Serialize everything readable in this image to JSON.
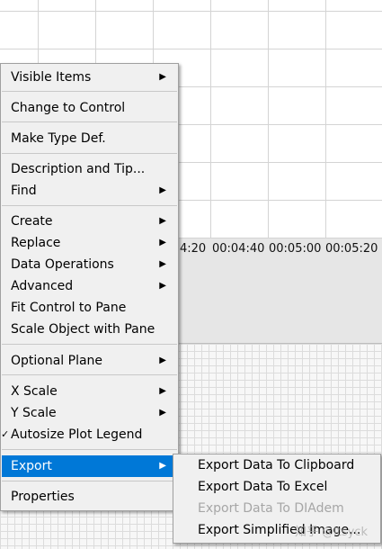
{
  "graph": {
    "x_tick_labels": [
      "4:20",
      "00:04:40",
      "00:05:00",
      "00:05:20"
    ]
  },
  "context_menu": {
    "items": {
      "visible_items": "Visible Items",
      "change_to_control": "Change to Control",
      "make_type_def": "Make Type Def.",
      "description_and_tip": "Description and Tip...",
      "find": "Find",
      "create": "Create",
      "replace": "Replace",
      "data_operations": "Data Operations",
      "advanced": "Advanced",
      "fit_control_to_pane": "Fit Control to Pane",
      "scale_object_with_pane": "Scale Object with Pane",
      "optional_plane": "Optional Plane",
      "x_scale": "X Scale",
      "y_scale": "Y Scale",
      "autosize_plot_legend": "Autosize Plot Legend",
      "export": "Export",
      "properties": "Properties"
    },
    "submenu_arrow": "▶",
    "check_mark": "✓",
    "highlight_color": "#0078d7"
  },
  "export_submenu": {
    "items": {
      "export_to_clipboard": "Export Data To Clipboard",
      "export_to_excel": "Export Data To Excel",
      "export_to_diadem": "Export Data To DIAdem",
      "export_simplified_image": "Export Simplified Image..."
    }
  },
  "watermark": "知乎 @ltsyck"
}
